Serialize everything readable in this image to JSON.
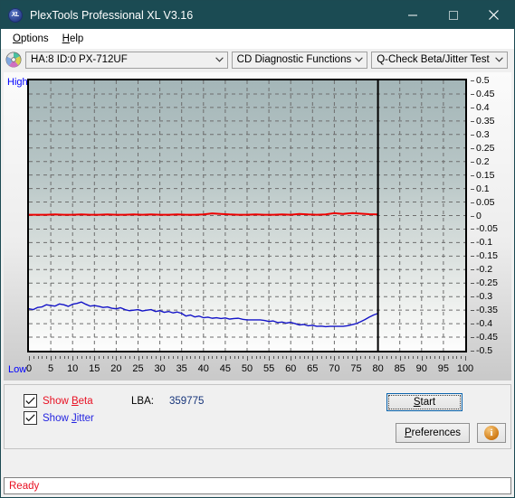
{
  "window": {
    "title": "PlexTools Professional XL V3.16",
    "icon": "xl-disc-icon",
    "minimize_label": "minimize-icon",
    "maximize_label": "maximize-icon",
    "close_label": "close-icon",
    "titlebar_color": "#1b4b53"
  },
  "menu": {
    "items": [
      {
        "label": "Options",
        "accel": "O"
      },
      {
        "label": "Help",
        "accel": "H"
      }
    ]
  },
  "toolbar": {
    "disc_icon": "cd-disc-icon",
    "drive_select": {
      "value": "HA:8 ID:0  PX-712UF",
      "options": [
        "HA:8 ID:0  PX-712UF"
      ]
    },
    "function_select": {
      "value": "CD Diagnostic Functions",
      "options": [
        "CD Diagnostic Functions"
      ]
    },
    "test_select": {
      "value": "Q-Check Beta/Jitter Test",
      "options": [
        "Q-Check Beta/Jitter Test"
      ]
    }
  },
  "chart_labels": {
    "high": "High",
    "low": "Low"
  },
  "chart_data": {
    "type": "line",
    "title": "Q-Check Beta/Jitter Test",
    "xlabel": "",
    "ylabel": "",
    "xlim": [
      0,
      100
    ],
    "ylim": [
      -0.5,
      0.5
    ],
    "grid": true,
    "legend": "none",
    "x_ticks": [
      0,
      5,
      10,
      15,
      20,
      25,
      30,
      35,
      40,
      45,
      50,
      55,
      60,
      65,
      70,
      75,
      80,
      85,
      90,
      95,
      100
    ],
    "y_ticks": [
      0.5,
      0.45,
      0.4,
      0.35,
      0.3,
      0.25,
      0.2,
      0.15,
      0.1,
      0.05,
      0,
      -0.05,
      -0.1,
      -0.15,
      -0.2,
      -0.25,
      -0.3,
      -0.35,
      -0.4,
      -0.45,
      -0.5
    ],
    "y_axis_side": "right",
    "data_end_x": 80,
    "marker_line_x": 80,
    "marker_line_color": "#000000",
    "series": [
      {
        "name": "Beta",
        "color": "#ee0000",
        "x": [
          0,
          2,
          4,
          6,
          8,
          10,
          12,
          14,
          16,
          18,
          20,
          22,
          24,
          26,
          28,
          30,
          32,
          34,
          36,
          38,
          40,
          42,
          44,
          46,
          48,
          50,
          52,
          54,
          56,
          58,
          60,
          62,
          64,
          66,
          68,
          70,
          72,
          74,
          76,
          78,
          80
        ],
        "values": [
          0.003,
          0.003,
          0.003,
          0.004,
          0.003,
          0.003,
          0.004,
          0.003,
          0.003,
          0.004,
          0.003,
          0.003,
          0.004,
          0.003,
          0.004,
          0.003,
          0.003,
          0.004,
          0.003,
          0.003,
          0.004,
          0.008,
          0.006,
          0.004,
          0.003,
          0.003,
          0.004,
          0.003,
          0.003,
          0.004,
          0.003,
          0.006,
          0.004,
          0.003,
          0.004,
          0.009,
          0.006,
          0.009,
          0.007,
          0.005,
          0.004
        ]
      },
      {
        "name": "Jitter",
        "color": "#1414c8",
        "x": [
          0,
          1,
          2,
          3,
          4,
          5,
          6,
          7,
          8,
          9,
          10,
          11,
          12,
          13,
          14,
          15,
          16,
          17,
          18,
          19,
          20,
          21,
          22,
          23,
          24,
          25,
          26,
          27,
          28,
          29,
          30,
          31,
          32,
          33,
          34,
          35,
          36,
          37,
          38,
          39,
          40,
          41,
          42,
          43,
          44,
          45,
          46,
          47,
          48,
          49,
          50,
          51,
          52,
          53,
          54,
          55,
          56,
          57,
          58,
          59,
          60,
          61,
          62,
          63,
          64,
          65,
          66,
          67,
          68,
          69,
          70,
          71,
          72,
          73,
          74,
          75,
          76,
          77,
          78,
          79,
          80
        ],
        "values": [
          -0.345,
          -0.348,
          -0.34,
          -0.338,
          -0.33,
          -0.333,
          -0.335,
          -0.327,
          -0.33,
          -0.336,
          -0.328,
          -0.325,
          -0.32,
          -0.328,
          -0.335,
          -0.333,
          -0.336,
          -0.34,
          -0.338,
          -0.343,
          -0.345,
          -0.341,
          -0.348,
          -0.352,
          -0.35,
          -0.348,
          -0.353,
          -0.35,
          -0.348,
          -0.355,
          -0.352,
          -0.358,
          -0.355,
          -0.36,
          -0.357,
          -0.362,
          -0.372,
          -0.368,
          -0.375,
          -0.372,
          -0.378,
          -0.376,
          -0.38,
          -0.378,
          -0.381,
          -0.379,
          -0.383,
          -0.381,
          -0.38,
          -0.384,
          -0.386,
          -0.386,
          -0.386,
          -0.386,
          -0.388,
          -0.392,
          -0.39,
          -0.396,
          -0.394,
          -0.398,
          -0.395,
          -0.4,
          -0.405,
          -0.403,
          -0.408,
          -0.406,
          -0.41,
          -0.409,
          -0.411,
          -0.41,
          -0.41,
          -0.41,
          -0.41,
          -0.408,
          -0.404,
          -0.4,
          -0.393,
          -0.385,
          -0.376,
          -0.368,
          -0.362
        ]
      }
    ]
  },
  "controls": {
    "show_beta": {
      "label_pre": "Show ",
      "label_accel": "B",
      "label_post": "eta",
      "checked": true,
      "color": "#e81123"
    },
    "show_jitter": {
      "label_pre": "Show ",
      "label_accel": "J",
      "label_post": "itter",
      "checked": true,
      "color": "#2424e0"
    },
    "lba_label": "LBA:",
    "lba_value": "359775",
    "start_button": {
      "pre": "",
      "accel": "S",
      "post": "tart"
    },
    "preferences_button": {
      "pre": "",
      "accel": "P",
      "post": "references"
    },
    "info_button": "info-icon"
  },
  "statusbar": {
    "text": "Ready",
    "color": "#e81123"
  }
}
